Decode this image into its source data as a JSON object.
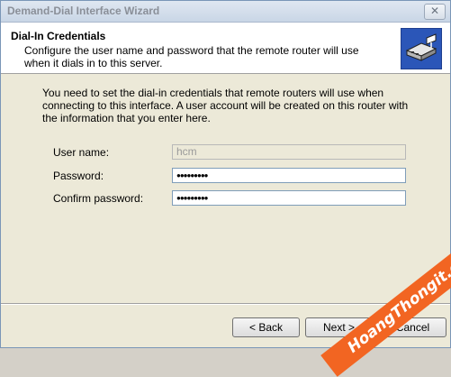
{
  "window": {
    "title": "Demand-Dial Interface Wizard",
    "close_glyph": "✕"
  },
  "header": {
    "title": "Dial-In Credentials",
    "subtitle": "Configure the user name and password that the remote router will use when it dials in to this server.",
    "icon": "router-network-icon"
  },
  "body": {
    "intro": "You need to set the dial-in credentials that remote routers will use when connecting to this interface. A user account will be created on this router with the information that you enter here.",
    "fields": {
      "username_label": "User name:",
      "username_value": "hcm",
      "password_label": "Password:",
      "password_value": "●●●●●●●●●",
      "confirm_label": "Confirm password:",
      "confirm_value": "●●●●●●●●●"
    }
  },
  "buttons": {
    "back": "< Back",
    "next": "Next >",
    "cancel": "Cancel"
  },
  "watermark": {
    "text": "HoangThongit.com",
    "color": "#f26522"
  }
}
